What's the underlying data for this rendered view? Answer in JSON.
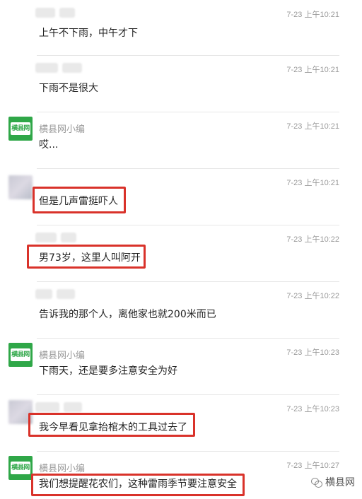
{
  "messages": [
    {
      "time": "7-23 上午10:21",
      "name": "",
      "text": "上午不下雨，中午才下"
    },
    {
      "time": "7-23 上午10:21",
      "name": "",
      "text": "下雨不是很大"
    },
    {
      "time": "7-23 上午10:21",
      "name": "横县网小编",
      "text": "哎..."
    },
    {
      "time": "7-23 上午10:21",
      "name": "",
      "text": "但是几声雷挺吓人"
    },
    {
      "time": "7-23 上午10:22",
      "name": "",
      "text": "男73岁，这里人叫阿开"
    },
    {
      "time": "7-23 上午10:22",
      "name": "",
      "text": "告诉我的那个人，离他家也就200米而已"
    },
    {
      "time": "7-23 上午10:23",
      "name": "横县网小编",
      "text": "下雨天，还是要多注意安全为好"
    },
    {
      "time": "7-23 上午10:23",
      "name": "",
      "text": "我今早看见拿抬棺木的工具过去了"
    },
    {
      "time": "7-23 上午10:27",
      "name": "横县网小编",
      "text": "我们想提醒花农们，这种雷雨季节要注意安全"
    }
  ],
  "logo_text": "横县网",
  "watermark": "横县网",
  "colors": {
    "highlight_border": "#d9322a",
    "logo_green": "#2fa748"
  }
}
